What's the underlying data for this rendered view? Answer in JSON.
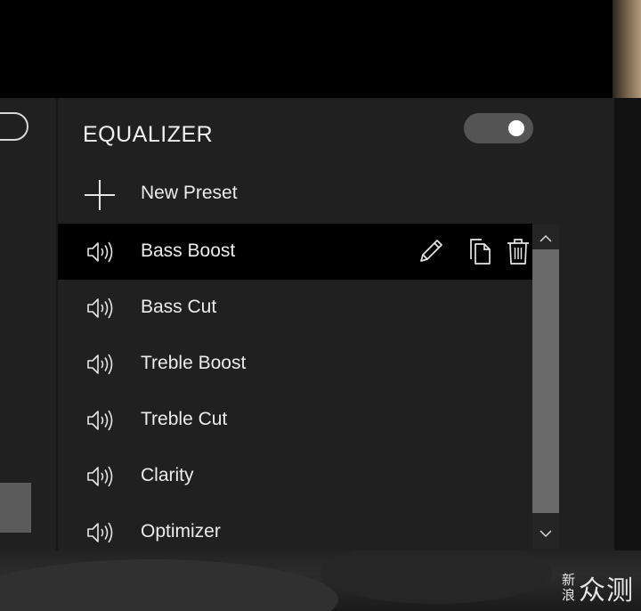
{
  "equalizer": {
    "title": "EQUALIZER",
    "enabled": true,
    "new_preset_label": "New Preset",
    "presets": [
      {
        "label": "Bass Boost",
        "selected": true
      },
      {
        "label": "Bass Cut",
        "selected": false
      },
      {
        "label": "Treble Boost",
        "selected": false
      },
      {
        "label": "Treble Cut",
        "selected": false
      },
      {
        "label": "Clarity",
        "selected": false
      },
      {
        "label": "Optimizer",
        "selected": false
      }
    ]
  },
  "icons": {
    "preset": "speaker-icon",
    "add": "plus-icon",
    "edit": "pencil-icon",
    "duplicate": "copy-icon",
    "delete": "trash-icon"
  },
  "watermark": {
    "small_top": "新",
    "small_bottom": "浪",
    "big": "众测"
  },
  "colors": {
    "panel_bg": "#202020",
    "selected_bg": "#000000",
    "text": "#ececec",
    "toggle_bg": "#545454",
    "scroll_thumb": "#6a6a6a"
  }
}
